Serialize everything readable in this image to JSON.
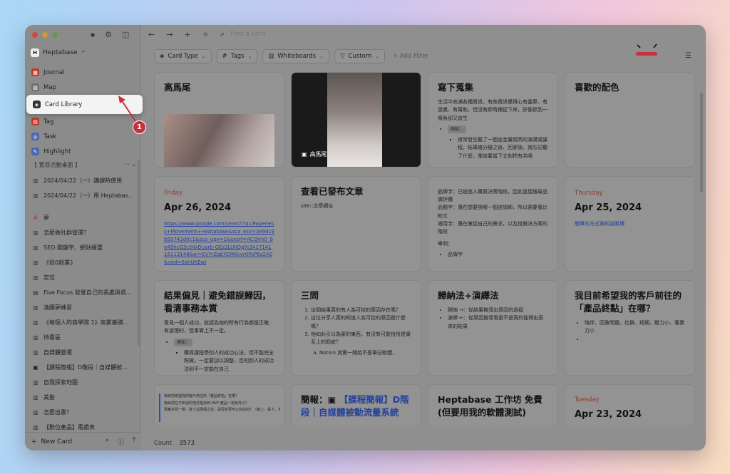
{
  "colors": {
    "accent_red": "#c8303f",
    "link_blue": "#1f3fa6"
  },
  "sidebar": {
    "workspace": "Heptabase",
    "nav": [
      {
        "label": "Journal",
        "icon": "journal-icon",
        "color": "#c0392b"
      },
      {
        "label": "Map",
        "icon": "map-icon",
        "color": "#7a7a7a"
      },
      {
        "label": "Card Library",
        "icon": "card-library-icon",
        "color": "#333333"
      },
      {
        "label": "Tag",
        "icon": "tag-icon",
        "color": "#c0392b"
      },
      {
        "label": "Task",
        "icon": "task-icon",
        "color": "#4a66b0"
      },
      {
        "label": "Highlight",
        "icon": "highlight-icon",
        "color": "#4a66b0"
      }
    ],
    "section_title": "【 置目活動桌面 】",
    "section_more": "···  ⌄",
    "items": [
      {
        "icon": "▥",
        "label": "2024/04/22（一）講課時使用"
      },
      {
        "icon": "▥",
        "label": "2024/04/22（一）用 Heptabas..."
      },
      {
        "icon": "#",
        "label": "夢"
      },
      {
        "icon": "▥",
        "label": "怎麼做社群營運？"
      },
      {
        "icon": "▥",
        "label": "SEO 關鍵字、網站權重"
      },
      {
        "icon": "▥",
        "label": "《從0創業》"
      },
      {
        "icon": "▥",
        "label": "定位"
      },
      {
        "icon": "▤",
        "label": "Five Focus 發覺自己的長處與資..."
      },
      {
        "icon": "▥",
        "label": "清醒夢練習"
      },
      {
        "icon": "▥",
        "label": "《每個人的商學院 1》商業基礎..."
      },
      {
        "icon": "▥",
        "label": "待看區"
      },
      {
        "icon": "▥",
        "label": "自媒體營運"
      },
      {
        "icon": "▣",
        "label": "【課程簡報】D階段｜自媒體被..."
      },
      {
        "icon": "▥",
        "label": "自我探索地圖"
      },
      {
        "icon": "▥",
        "label": "美髮"
      },
      {
        "icon": "▥",
        "label": "怎麼出書？"
      },
      {
        "icon": "▥",
        "label": "【數位產品】需處表"
      }
    ],
    "new_card": "New Card"
  },
  "toolbar": {
    "search_placeholder": "Find a card"
  },
  "filters": {
    "card_type": "Card Type",
    "tags": "Tags",
    "whiteboards": "Whiteboards",
    "custom": "Custom",
    "add_filter": "Add Filter"
  },
  "cards": {
    "c1": {
      "title": "高馬尾"
    },
    "c2": {
      "label": "高馬尾"
    },
    "c3": {
      "title": "寫下蒐集",
      "text": "生活中充滿各種資訊，有些資訊覺得心有靈犀、有感覺、有幫助，但沒有即時捕捉下來，好像抓到一條魚卻又放生",
      "chip": "例如：",
      "bullet": "很常發生聽了一個含金量超高的演講或課程，結果幾分鐘之後、回家後，就忘記聽了什麼，應該要當下立刻把有共鳴"
    },
    "c4": {
      "title": "喜歡的配色"
    },
    "c5": {
      "weekday": "Friday",
      "date": "Apr 26, 2024",
      "link": "https://www.google.com/search?q=Paperless+Movement+Heptabase&sca_esv=3e9dc9b55742d0c1&sca_upv=1&sxsrf=ACQVn0_9e49hcG3ctHxDuorb-GEz2LUhDg%3A1714116113148&ei=EVYrZqbYCMKkvr0PzP6z2A0&ved=0ahUKEwj"
    },
    "c6": {
      "title": "查看已發布文章",
      "text": "site::文章網址"
    },
    "c7": {
      "lines": [
        "品牌字：已經進入購買決策階段，因此直接搜尋品牌評價",
        "品類字：還在想要挑哪一個諮詢師，所以需要看比較文",
        "適用字：還在確認自己的需求，以及找解決方案的階段"
      ],
      "example": "舉例：",
      "bullet": "品牌字"
    },
    "c8": {
      "weekday": "Thursday",
      "date": "Apr 25, 2024",
      "link": "簡單的方式做知識累積"
    },
    "c9": {
      "title": "結果偏見｜避免錯誤歸因，看清事務本質",
      "text": "看見一個人成功，就認為他的所有行為都是正確、有道理的，但事實上不一定。",
      "chip": "例如：",
      "bullet": "購買課程學別人的成功心法，但不能完全照做，一定要加以調整，否則別人的成功法則不一定能在自己"
    },
    "c10": {
      "title": "三問",
      "items": [
        "這個結果真的有人為可控的原因存在嗎？",
        "這位分享人真的知道人為可控的原因是什麼嗎？",
        "他如此引以為豪的東西，有沒有可能恰恰是實互上的瑕疵？"
      ],
      "sub": "Notion 其實一開始不是筆記軟體，"
    },
    "c11": {
      "title": "歸納法+演繹法",
      "items": [
        "歸納 →：從結果推導出原因的過程",
        "演繹 ←：從原因推導看是不是真的能得出原來的結果"
      ]
    },
    "c12": {
      "title": "我目前希望我的客戶前往的「產品終點」在哪？",
      "items": [
        "陪伴、回答問題、社群、短期、壓力小、專業力小",
        ""
      ]
    },
    "c13": {
      "lines": [
        "我目前希望我的客戶前往的「產品終點」在哪？",
        "我目前在不知道的地方能找到 MVP 產品一定就可以？",
        "現實多問一題：除了這兩個之外，是否有更可以前往的？（線上、長下、平行）"
      ]
    },
    "c14": {
      "title_pre": "簡報：",
      "title_link": "【課程簡報】D階段｜自媒體被動流量系統"
    },
    "c15": {
      "title": "Heptabase 工作坊 免費(但要用我的軟體測試)"
    },
    "c16": {
      "weekday": "Tuesday",
      "date": "Apr 23, 2024"
    }
  },
  "footer": {
    "count_label": "Count",
    "count_value": "3573"
  },
  "annotation": {
    "badge": "1"
  }
}
